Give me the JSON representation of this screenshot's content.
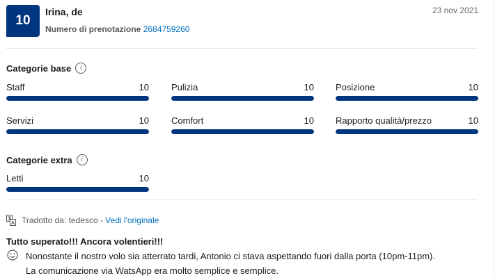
{
  "review": {
    "score": "10",
    "reviewer": "Irina, de",
    "booking_label": "Numero di prenotazione",
    "booking_number": "2684759260",
    "date": "23 nov 2021"
  },
  "base": {
    "title": "Categorie base",
    "categories": [
      {
        "label": "Staff",
        "score": "10",
        "fill": 1.0
      },
      {
        "label": "Pulizia",
        "score": "10",
        "fill": 1.0
      },
      {
        "label": "Posizione",
        "score": "10",
        "fill": 1.0
      },
      {
        "label": "Servizi",
        "score": "10",
        "fill": 1.0
      },
      {
        "label": "Comfort",
        "score": "10",
        "fill": 1.0
      },
      {
        "label": "Rapporto qualità/prezzo",
        "score": "10",
        "fill": 1.0
      }
    ]
  },
  "extra": {
    "title": "Categorie extra",
    "categories": [
      {
        "label": "Letti",
        "score": "10",
        "fill": 1.0
      }
    ]
  },
  "translation": {
    "label": "Tradotto da: tedesco -",
    "link": "Vedi l'originale"
  },
  "text": {
    "title": "Tutto superato!!! Ancora volentieri!!!",
    "line1": "Nonostante il nostro volo sia atterrato tardi, Antonio ci stava aspettando fuori dalla porta (10pm-11pm).",
    "line2": "La comunicazione via WatsApp era molto semplice e semplice."
  },
  "colors": {
    "brand": "#003580",
    "link": "#0071c2"
  },
  "icons": [
    "info-icon",
    "translate-icon",
    "smiley-icon"
  ]
}
